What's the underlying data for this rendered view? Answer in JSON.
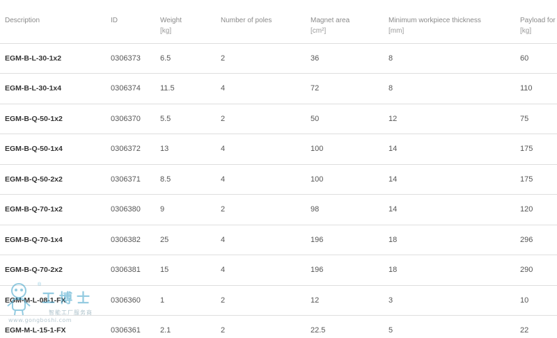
{
  "table": {
    "headers": [
      {
        "label": "Description",
        "unit": ""
      },
      {
        "label": "ID",
        "unit": ""
      },
      {
        "label": "Weight",
        "unit": "[kg]"
      },
      {
        "label": "Number of poles",
        "unit": ""
      },
      {
        "label": "Magnet area",
        "unit": "[cm²]"
      },
      {
        "label": "Minimum workpiece thickness",
        "unit": "[mm]"
      },
      {
        "label": "Payload for",
        "unit": "[kg]"
      }
    ],
    "rows": [
      [
        "EGM-B-L-30-1x2",
        "0306373",
        "6.5",
        "2",
        "36",
        "8",
        "60"
      ],
      [
        "EGM-B-L-30-1x4",
        "0306374",
        "11.5",
        "4",
        "72",
        "8",
        "110"
      ],
      [
        "EGM-B-Q-50-1x2",
        "0306370",
        "5.5",
        "2",
        "50",
        "12",
        "75"
      ],
      [
        "EGM-B-Q-50-1x4",
        "0306372",
        "13",
        "4",
        "100",
        "14",
        "175"
      ],
      [
        "EGM-B-Q-50-2x2",
        "0306371",
        "8.5",
        "4",
        "100",
        "14",
        "175"
      ],
      [
        "EGM-B-Q-70-1x2",
        "0306380",
        "9",
        "2",
        "98",
        "14",
        "120"
      ],
      [
        "EGM-B-Q-70-1x4",
        "0306382",
        "25",
        "4",
        "196",
        "18",
        "296"
      ],
      [
        "EGM-B-Q-70-2x2",
        "0306381",
        "15",
        "4",
        "196",
        "18",
        "290"
      ],
      [
        "EGM-M-L-08-1-FX",
        "0306360",
        "1",
        "2",
        "12",
        "3",
        "10"
      ],
      [
        "EGM-M-L-15-1-FX",
        "0306361",
        "2.1",
        "2",
        "22.5",
        "5",
        "22"
      ]
    ]
  },
  "watermark": {
    "brand_cn": "工博士",
    "registered": "®",
    "tagline_cn": "智能工厂服务商",
    "url": "www.gongboshi.com",
    "mascot_icon": "robot-mascot-icon",
    "color": "#3aa0c8"
  }
}
